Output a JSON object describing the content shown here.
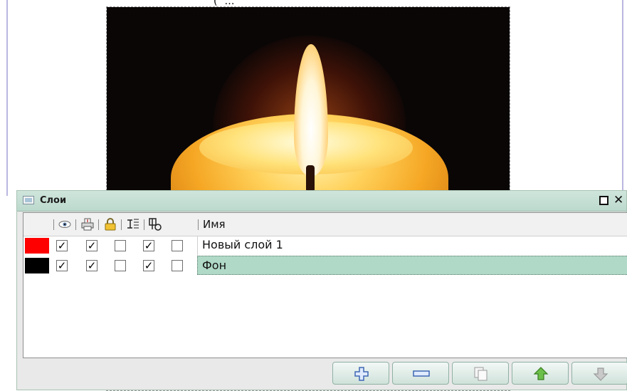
{
  "canvas": {
    "top_partial_text": "(…)"
  },
  "layers_panel": {
    "title": "Слои",
    "columns": {
      "visible_icon": "eye-icon",
      "printable_icon": "printer-icon",
      "locked_icon": "lock-icon",
      "flatten_icon": "layer-flatten-icon",
      "outline_icon": "outline-icon",
      "name_header": "Имя"
    },
    "layers": [
      {
        "color": "#ff0000",
        "visible": true,
        "printable": true,
        "locked": false,
        "flatten": true,
        "outline": false,
        "name": "Новый слой 1",
        "selected": false
      },
      {
        "color": "#000000",
        "visible": true,
        "printable": true,
        "locked": false,
        "flatten": true,
        "outline": false,
        "name": "Фон",
        "selected": true
      }
    ],
    "toolbar": {
      "add": "plus-icon",
      "remove": "minus-icon",
      "duplicate": "duplicate-icon",
      "raise": "arrow-up-icon",
      "lower": "arrow-down-icon"
    }
  },
  "colors": {
    "selection": "#b0d9c7",
    "titlebar": "#c7dfd5"
  }
}
